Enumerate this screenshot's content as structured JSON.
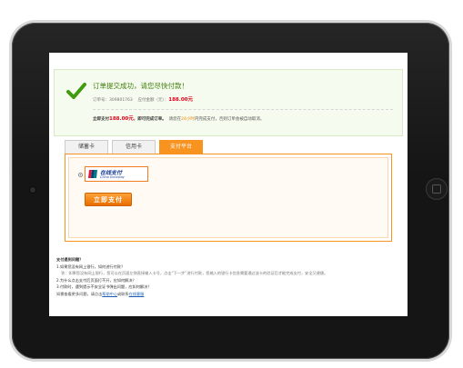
{
  "success": {
    "title": "订单提交成功，请您尽快付款！",
    "order_no_label": "订单号：",
    "order_no": "309801763",
    "amount_label": "应付金额（元）：",
    "amount": "188.00元"
  },
  "pay_line": {
    "pay_now_label": "立即支付",
    "pay_now_amount": "188.00元",
    "pay_now_suffix": "，即可完成订单。",
    "notice_prefix": "请您在",
    "notice_hours": "24小时",
    "notice_suffix": "内完成支付，否则订单会被自动取消。"
  },
  "tabs": [
    {
      "label": "储蓄卡",
      "active": false
    },
    {
      "label": "信用卡",
      "active": false
    },
    {
      "label": "支付平台",
      "active": true
    }
  ],
  "payment_option": {
    "name": "在线支付",
    "sub": "China Unionpay",
    "selected": true
  },
  "pay_button": "立即支付",
  "help": {
    "title": "支付遇到问题？",
    "items": [
      {
        "q": "1.如果您没有网上银行，如何进行付款？",
        "a": "答：如果您没有网上银行，您可以在页面左侧直接输入卡号，点击“下一步”进行付款，您输入的银行卡信息需要通过该卡的验证后才能完成支付，安全又便捷。"
      },
      {
        "q": "2.为什么点击支付后页面打不开，应如何解决？",
        "a": ""
      },
      {
        "q": "3.付款时，遇到提示不安全证书弹出问题，应如何解决？",
        "a": ""
      }
    ],
    "footer_prefix": "如需查看更多问题，请点击",
    "footer_link1": "帮助中心",
    "footer_mid": "或联系",
    "footer_link2": "在线客服"
  },
  "colors": {
    "accent": "#f7931e",
    "success": "#3f7d0a",
    "price": "#e2001a",
    "frame": "#151515"
  }
}
